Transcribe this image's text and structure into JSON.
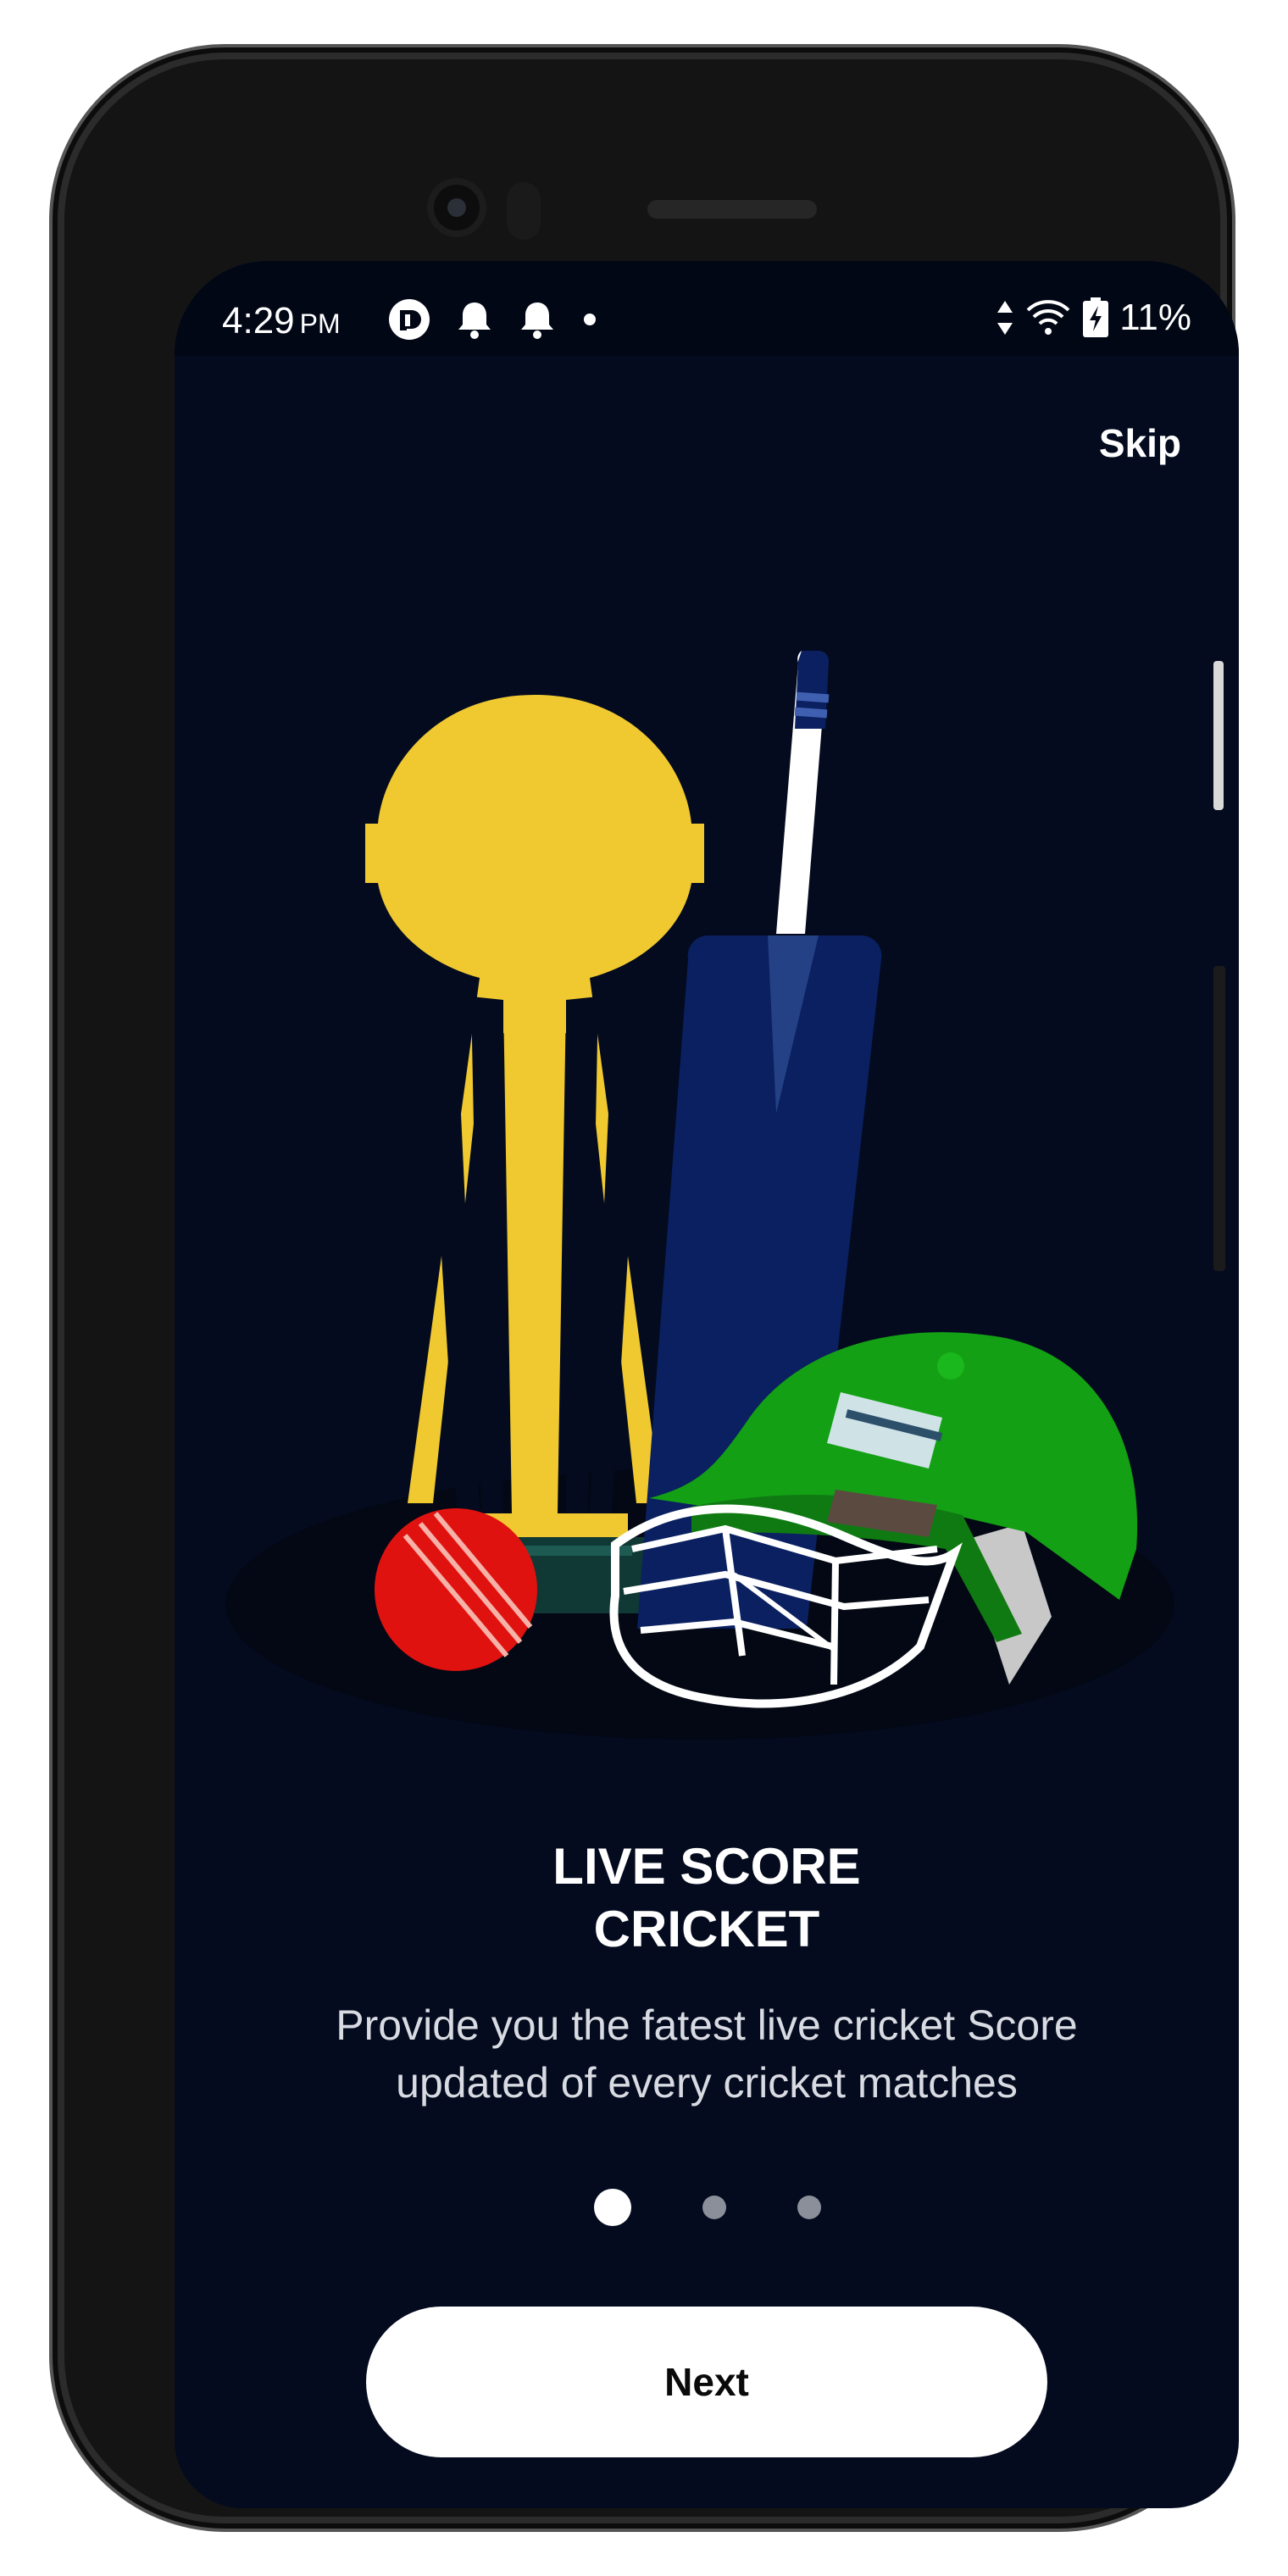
{
  "status_bar": {
    "time": "4:29",
    "ampm": "PM",
    "battery_percent": "11%",
    "left_icons": [
      "pocket-casts-icon",
      "bell-icon",
      "bell-icon",
      "dot-icon"
    ],
    "right_icons": [
      "data-arrows-icon",
      "wifi-icon",
      "battery-charging-icon"
    ]
  },
  "onboarding": {
    "skip_label": "Skip",
    "title": "LIVE SCORE\nCRICKET",
    "description": "Provide you the fatest live cricket Score updated of every cricket matches",
    "page_count": 3,
    "current_page": 1,
    "next_label": "Next",
    "illustration": [
      "trophy",
      "cricket-bat",
      "cricket-ball",
      "cricket-helmet"
    ]
  },
  "colors": {
    "background": "#040b1f",
    "trophy": "#f0c931",
    "bat": "#0a2060",
    "ball": "#e0120f",
    "helmet": "#14a015",
    "button": "#ffffff"
  }
}
